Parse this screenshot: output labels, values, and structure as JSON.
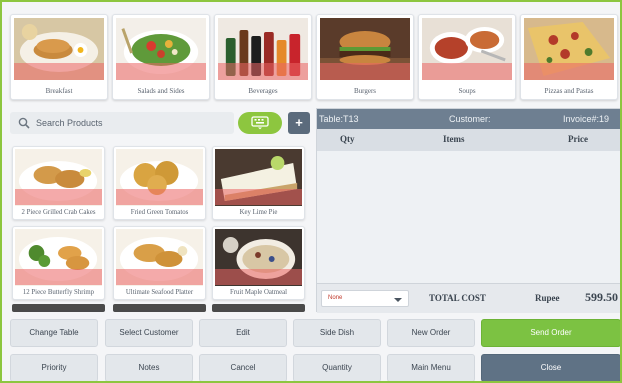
{
  "categories": [
    {
      "label": "Breakfast",
      "icon": "breakfast-plate-image"
    },
    {
      "label": "Salads and Sides",
      "icon": "salad-image"
    },
    {
      "label": "Beverages",
      "icon": "beverages-image"
    },
    {
      "label": "Burgers",
      "icon": "burger-image"
    },
    {
      "label": "Soups",
      "icon": "soup-image"
    },
    {
      "label": "Pizzas and Pastas",
      "icon": "pizza-image"
    }
  ],
  "search": {
    "placeholder": "Search Products",
    "icon": "search-icon"
  },
  "toolbar": {
    "keyboard_icon": "keyboard-icon",
    "plus_label": "+"
  },
  "products": [
    {
      "label": "2 Piece Grilled Crab Cakes"
    },
    {
      "label": "Fried Green Tomatos"
    },
    {
      "label": "Key Lime Pie"
    },
    {
      "label": "12 Piece Butterfly Shrimp"
    },
    {
      "label": "Ultimate Seafood Platter"
    },
    {
      "label": "Fruit Maple Oatmeal"
    }
  ],
  "order": {
    "table": "Table:T13",
    "customer": "Customer:",
    "invoice": "Invoice#:19",
    "columns": {
      "qty": "Qty",
      "items": "Items",
      "price": "Price"
    },
    "select_value": "None",
    "total_label": "TOTAL COST",
    "currency": "Rupee",
    "total_amount": "599.50"
  },
  "actions": {
    "change_table": "Change Table",
    "select_customer": "Select Customer",
    "edit": "Edit",
    "side_dish": "Side Dish",
    "new_order": "New Order",
    "send_order": "Send Order",
    "priority": "Priority",
    "notes": "Notes",
    "cancel": "Cancel",
    "quantity": "Quantity",
    "main_menu": "Main Menu",
    "close": "Close"
  },
  "colors": {
    "accent": "#8dc63f",
    "send": "#7cc242",
    "header": "#6e7f91",
    "close": "#5f7285"
  }
}
